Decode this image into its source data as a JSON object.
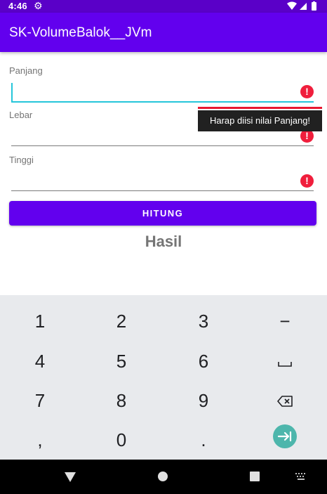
{
  "status_bar": {
    "time": "4:46"
  },
  "app_bar": {
    "title": "SK-VolumeBalok__JVm"
  },
  "form": {
    "panjang_label": "Panjang",
    "lebar_label": "Lebar",
    "tinggi_label": "Tinggi",
    "panjang_value": "",
    "lebar_value": "",
    "tinggi_value": "",
    "error_glyph": "!",
    "error_tooltip": "Harap diisi nilai Panjang!"
  },
  "button": {
    "hitung_label": "HITUNG"
  },
  "result": {
    "hasil_label": "Hasil"
  },
  "keyboard": {
    "keys": [
      "1",
      "2",
      "3",
      "−",
      "4",
      "5",
      "6",
      "␣",
      "7",
      "8",
      "9",
      "⌫",
      ",",
      "0",
      ".",
      "⇥"
    ]
  },
  "colors": {
    "primary": "#6200ee",
    "status_bar": "#5a00c8",
    "accent_cyan": "#26c6da",
    "error_red": "#f01e3c",
    "enter_teal": "#4db6ac"
  },
  "icons": {
    "status": [
      "settings-gear-icon",
      "wifi-icon",
      "cell-signal-icon",
      "battery-icon"
    ],
    "nav": [
      "back-icon",
      "home-icon",
      "recents-icon",
      "keyboard-switch-icon"
    ]
  }
}
